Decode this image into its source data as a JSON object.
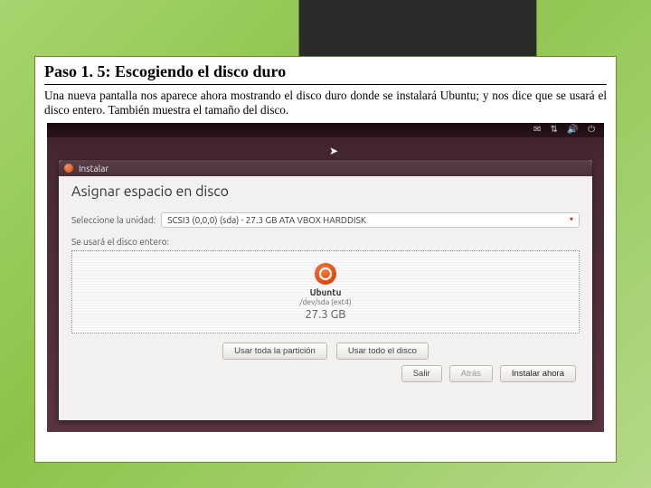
{
  "slide": {
    "title": "Paso 1. 5: Escogiendo el disco duro",
    "description": "Una nueva pantalla nos aparece ahora mostrando el disco duro donde se instalará Ubuntu; y nos dice que se usará el disco entero. También muestra el tamaño del disco."
  },
  "installer": {
    "window_title": "Instalar",
    "dialog_title": "Asignar espacio en disco",
    "drive_label": "Seleccione la unidad:",
    "drive_value": "SCSI3 (0,0,0) (sda) - 27.3 GB ATA VBOX HARDDISK",
    "entire_disk_label": "Se usará el disco entero:",
    "os_name": "Ubuntu",
    "device": "/dev/sda (ext4)",
    "disk_size": "27.3 GB",
    "buttons": {
      "use_partition": "Usar toda la partición",
      "use_disk": "Usar todo el disco",
      "quit": "Salir",
      "back": "Atrás",
      "install": "Instalar ahora"
    }
  },
  "panel_icons": "✉ ⇅ 🔊 ⏻"
}
